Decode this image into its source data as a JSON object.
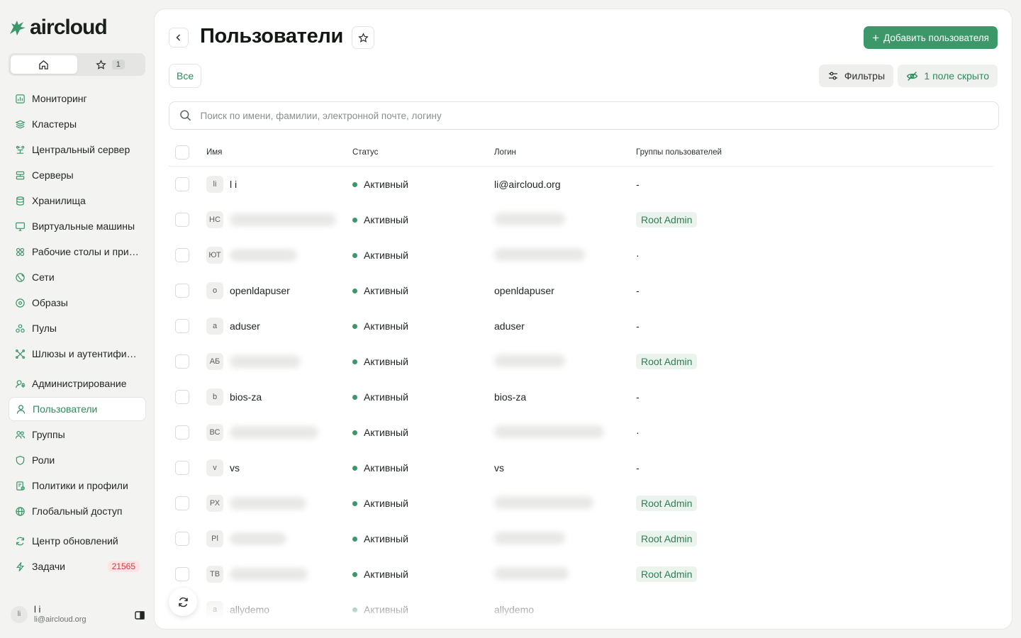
{
  "brand": {
    "name": "aircloud",
    "color": "#3c9868"
  },
  "switcher": {
    "fav_count": "1"
  },
  "nav": [
    {
      "label": "Мониторинг",
      "icon": "monitoring-icon"
    },
    {
      "label": "Кластеры",
      "icon": "cluster-icon"
    },
    {
      "label": "Центральный сервер",
      "icon": "central-server-icon"
    },
    {
      "label": "Серверы",
      "icon": "server-icon"
    },
    {
      "label": "Хранилища",
      "icon": "database-icon"
    },
    {
      "label": "Виртуальные машины",
      "icon": "monitor-icon"
    },
    {
      "label": "Рабочие столы и прил...",
      "icon": "desktops-icon"
    },
    {
      "label": "Сети",
      "icon": "network-icon"
    },
    {
      "label": "Образы",
      "icon": "disc-icon"
    },
    {
      "label": "Пулы",
      "icon": "pool-icon"
    },
    {
      "label": "Шлюзы и аутентифика...",
      "icon": "gateway-icon"
    },
    {
      "label": "Администрирование",
      "icon": "admin-icon"
    },
    {
      "label": "Пользователи",
      "icon": "user-icon",
      "active": true
    },
    {
      "label": "Группы",
      "icon": "group-icon"
    },
    {
      "label": "Роли",
      "icon": "shield-icon"
    },
    {
      "label": "Политики и профили",
      "icon": "policy-icon"
    },
    {
      "label": "Глобальный доступ",
      "icon": "globe-icon"
    },
    {
      "label": "Центр обновлений",
      "icon": "refresh-icon"
    },
    {
      "label": "Задачи",
      "icon": "bolt-icon",
      "badge": "21565"
    }
  ],
  "user": {
    "initials": "li",
    "name": "l i",
    "email": "li@aircloud.org"
  },
  "page": {
    "title": "Пользователи",
    "add_label": "Добавить пользователя",
    "tab_all": "Все",
    "filters_label": "Фильтры",
    "hidden_label": "1 поле скрыто",
    "search_placeholder": "Поиск по имени, фамилии, электронной почте, логину"
  },
  "table": {
    "headers": {
      "name": "Имя",
      "status": "Статус",
      "login": "Логин",
      "groups": "Группы пользователей"
    },
    "rows": [
      {
        "ini": "li",
        "name": "l i",
        "status": "Активный",
        "login": "li@aircloud.org",
        "group": "-"
      },
      {
        "ini": "НС",
        "name": "",
        "status": "Активный",
        "login": "",
        "group": "Root Admin",
        "blur_name": 150,
        "blur_login": 100
      },
      {
        "ini": "ЮТ",
        "name": "",
        "status": "Активный",
        "login": "",
        "group": "·",
        "blur_name": 95,
        "blur_login": 128
      },
      {
        "ini": "o",
        "name": "openldapuser",
        "status": "Активный",
        "login": "openldapuser",
        "group": "-"
      },
      {
        "ini": "a",
        "name": "aduser",
        "status": "Активный",
        "login": "aduser",
        "group": "-"
      },
      {
        "ini": "АБ",
        "name": "",
        "status": "Активный",
        "login": "",
        "group": "Root Admin",
        "blur_name": 100,
        "blur_login": 100
      },
      {
        "ini": "b",
        "name": "bios-za",
        "status": "Активный",
        "login": "bios-za",
        "group": "-"
      },
      {
        "ini": "ВС",
        "name": "",
        "status": "Активный",
        "login": "",
        "group": "·",
        "blur_name": 125,
        "blur_login": 155
      },
      {
        "ini": "v",
        "name": "vs",
        "status": "Активный",
        "login": "vs",
        "group": "-"
      },
      {
        "ini": "РХ",
        "name": "",
        "status": "Активный",
        "login": "",
        "group": "Root Admin",
        "blur_name": 108,
        "blur_login": 140
      },
      {
        "ini": "Pl",
        "name": "",
        "status": "Активный",
        "login": "",
        "group": "Root Admin",
        "blur_name": 80,
        "blur_login": 100
      },
      {
        "ini": "ТВ",
        "name": "",
        "status": "Активный",
        "login": "",
        "group": "Root Admin",
        "blur_name": 110,
        "blur_login": 105
      },
      {
        "ini": "a",
        "name": "allydemo",
        "status": "Активный",
        "login": "allydemo",
        "group": ""
      }
    ]
  }
}
